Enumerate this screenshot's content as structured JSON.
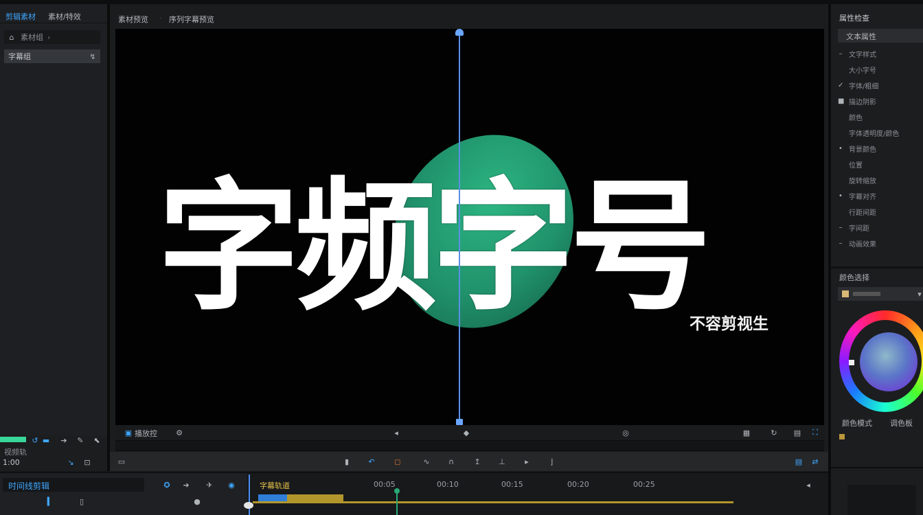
{
  "left_panel": {
    "tabs": [
      "剪辑素材",
      "素材/特效"
    ],
    "breadcrumb": "素材组",
    "selected_item": "字幕组"
  },
  "viewer": {
    "tabs": [
      "素材预览",
      "序列字幕预览"
    ],
    "headline": "字频字号",
    "subtitle": "不容剪视生",
    "bottom_label": "播放控"
  },
  "right_panel": {
    "title": "属性检查",
    "top_field": "文本属性",
    "properties": [
      {
        "label": "文字样式",
        "icon": "dash"
      },
      {
        "label": "大小字号",
        "icon": "none"
      },
      {
        "label": "字体/粗细",
        "icon": "check"
      },
      {
        "label": "描边阴影",
        "icon": "square"
      },
      {
        "label": "颜色",
        "icon": "none"
      },
      {
        "label": "字体透明度/颜色",
        "icon": "none"
      },
      {
        "label": "背景颜色",
        "icon": "dot"
      },
      {
        "label": "位置",
        "icon": "none"
      },
      {
        "label": "旋转缩放",
        "icon": "none"
      },
      {
        "label": "字幕对齐",
        "icon": "dot"
      },
      {
        "label": "行距间距",
        "icon": "none"
      },
      {
        "label": "字间距",
        "icon": "dash"
      },
      {
        "label": "动画效果",
        "icon": "dash"
      }
    ],
    "color_section_title": "颜色选择",
    "color_bottom_labels": [
      "颜色模式",
      "调色板"
    ]
  },
  "timeline": {
    "title": "时间线剪辑",
    "track_label": "视频轨",
    "timecode": "1:00",
    "clip_label": "字幕轨道",
    "ruler_labels": [
      "00:05",
      "00:10",
      "00:15",
      "00:20",
      "00:25"
    ]
  },
  "colors": {
    "accent": "#3fa7ff",
    "green": "#2aa877",
    "playhead": "#4a8ef5",
    "clip_blue": "#2f7fd8",
    "clip_gold": "#b3962b"
  }
}
